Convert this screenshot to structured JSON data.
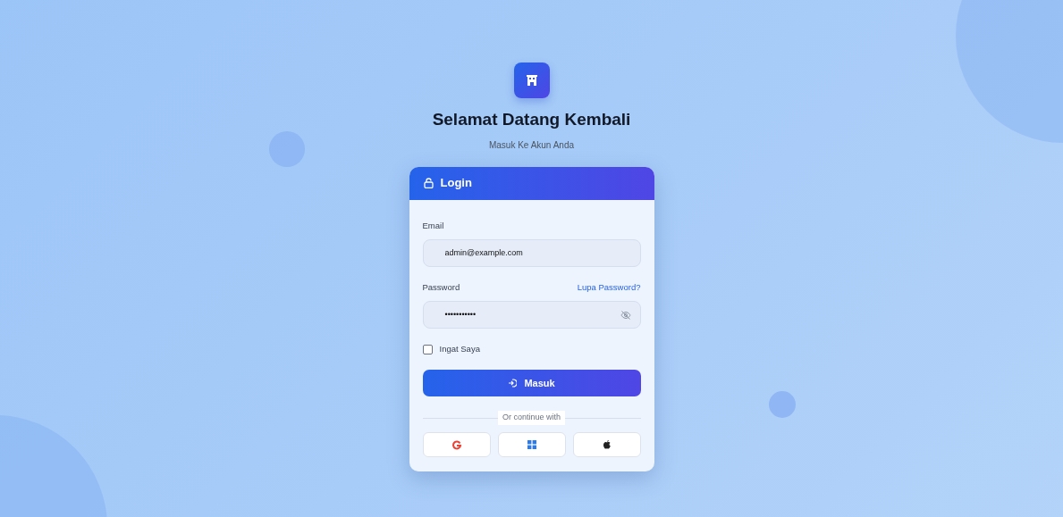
{
  "header": {
    "title": "Selamat Datang Kembali",
    "subtitle": "Masuk Ke Akun Anda"
  },
  "card": {
    "title": "Login",
    "email": {
      "label": "Email",
      "value": "admin@example.com"
    },
    "password": {
      "label": "Password",
      "value": "•••••••••••",
      "forgot_link": "Lupa Password?",
      "visible": false
    },
    "remember": {
      "label": "Ingat Saya",
      "checked": false
    },
    "submit": "Masuk",
    "divider": "Or continue with",
    "social": [
      {
        "kind": "google"
      },
      {
        "kind": "windows"
      },
      {
        "kind": "apple"
      }
    ]
  }
}
